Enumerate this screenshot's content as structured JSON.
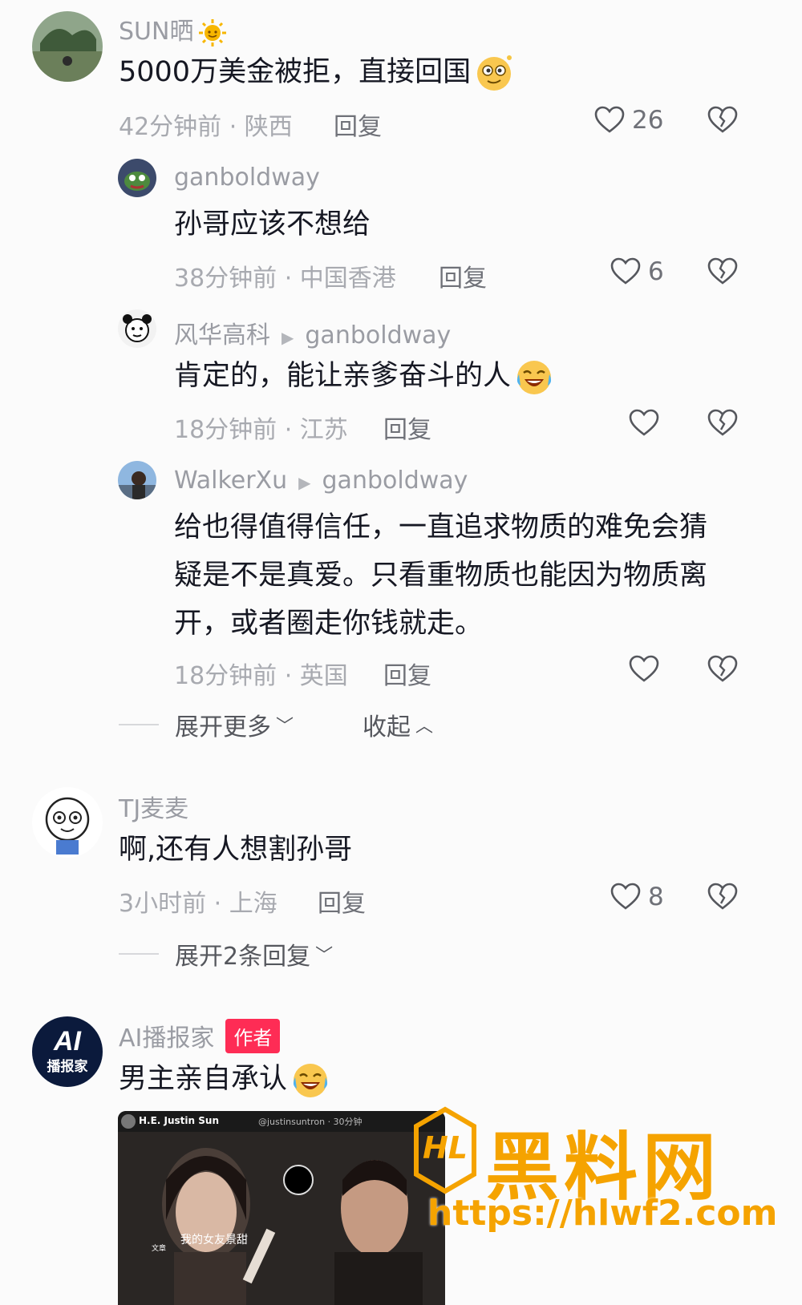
{
  "comments": [
    {
      "username": "SUN晒",
      "username_emoji": "sun-emoji",
      "text": "5000万美金被拒，直接回国",
      "text_emoji": "dizzy-face-emoji",
      "meta": "42分钟前 · 陕西",
      "reply_label": "回复",
      "likes": "26",
      "replies": [
        {
          "username": "ganboldway",
          "text": "孙哥应该不想给",
          "meta": "38分钟前 · 中国香港",
          "reply_label": "回复",
          "likes": "6"
        },
        {
          "username": "风华高科",
          "reply_to": "ganboldway",
          "text": "肯定的，能让亲爹奋斗的人",
          "text_emoji": "laughing-crying-emoji",
          "meta": "18分钟前 · 江苏",
          "reply_label": "回复",
          "likes": ""
        },
        {
          "username": "WalkerXu",
          "reply_to": "ganboldway",
          "text_lines": [
            "给也得值得信任，一直追求物质的难免会猜",
            "疑是不是真爱。只看重物质也能因为物质离",
            "开，或者圈走你钱就走。"
          ],
          "meta": "18分钟前 · 英国",
          "reply_label": "回复",
          "likes": ""
        }
      ],
      "expand_more_label": "展开更多",
      "collapse_label": "收起"
    },
    {
      "username": "TJ麦麦",
      "text": "啊,还有人想割孙哥",
      "meta": "3小时前 · 上海",
      "reply_label": "回复",
      "likes": "8",
      "expand_label": "展开2条回复"
    },
    {
      "username": "AI播报家",
      "author_badge": "作者",
      "text": "男主亲自承认",
      "text_emoji": "laughing-crying-emoji",
      "avatar_text": "AI",
      "avatar_subtext": "播报家",
      "embedded_image": {
        "header_name": "H.E. Justin Sun",
        "header_handle": "@justinsuntron · 30分钟",
        "caption": "我的女友景甜",
        "caption_tag": "文章"
      }
    }
  ],
  "watermark": {
    "logo_text": "HL",
    "brand": "黑料网",
    "url": "https://hlwf2.com",
    "color": "#f5a300"
  },
  "colors": {
    "background": "#fbfbfb",
    "text": "#161823",
    "meta": "#a8aab0",
    "author_badge": "#fe2c55"
  }
}
